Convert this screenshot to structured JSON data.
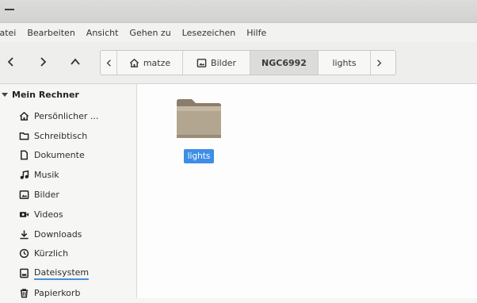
{
  "menubar": {
    "items": [
      "Datei",
      "Bearbeiten",
      "Ansicht",
      "Gehen zu",
      "Lesezeichen",
      "Hilfe"
    ]
  },
  "toolbar": {
    "back_icon": "chevron-left-icon",
    "forward_icon": "chevron-right-icon",
    "up_icon": "chevron-up-icon"
  },
  "pathbar": {
    "crumbs": [
      {
        "label": "matze",
        "icon": "home-icon"
      },
      {
        "label": "Bilder",
        "icon": "pictures-icon"
      },
      {
        "label": "NGC6992",
        "icon": ""
      },
      {
        "label": "lights",
        "icon": ""
      }
    ],
    "active": "NGC6992"
  },
  "sidebar": {
    "header": "Mein Rechner",
    "items": [
      {
        "label": "Persönlicher ...",
        "icon": "home-icon"
      },
      {
        "label": "Schreibtisch",
        "icon": "desktop-icon"
      },
      {
        "label": "Dokumente",
        "icon": "document-icon"
      },
      {
        "label": "Musik",
        "icon": "music-icon"
      },
      {
        "label": "Bilder",
        "icon": "pictures-icon"
      },
      {
        "label": "Videos",
        "icon": "video-icon"
      },
      {
        "label": "Downloads",
        "icon": "download-icon"
      },
      {
        "label": "Kürzlich",
        "icon": "clock-icon"
      },
      {
        "label": "Dateisystem",
        "icon": "drive-icon"
      },
      {
        "label": "Papierkorb",
        "icon": "trash-icon"
      }
    ]
  },
  "content": {
    "items": [
      {
        "name": "lights",
        "type": "folder",
        "selected": true
      }
    ]
  },
  "colors": {
    "selection": "#3d8ee6",
    "folder": "#a99a86"
  }
}
